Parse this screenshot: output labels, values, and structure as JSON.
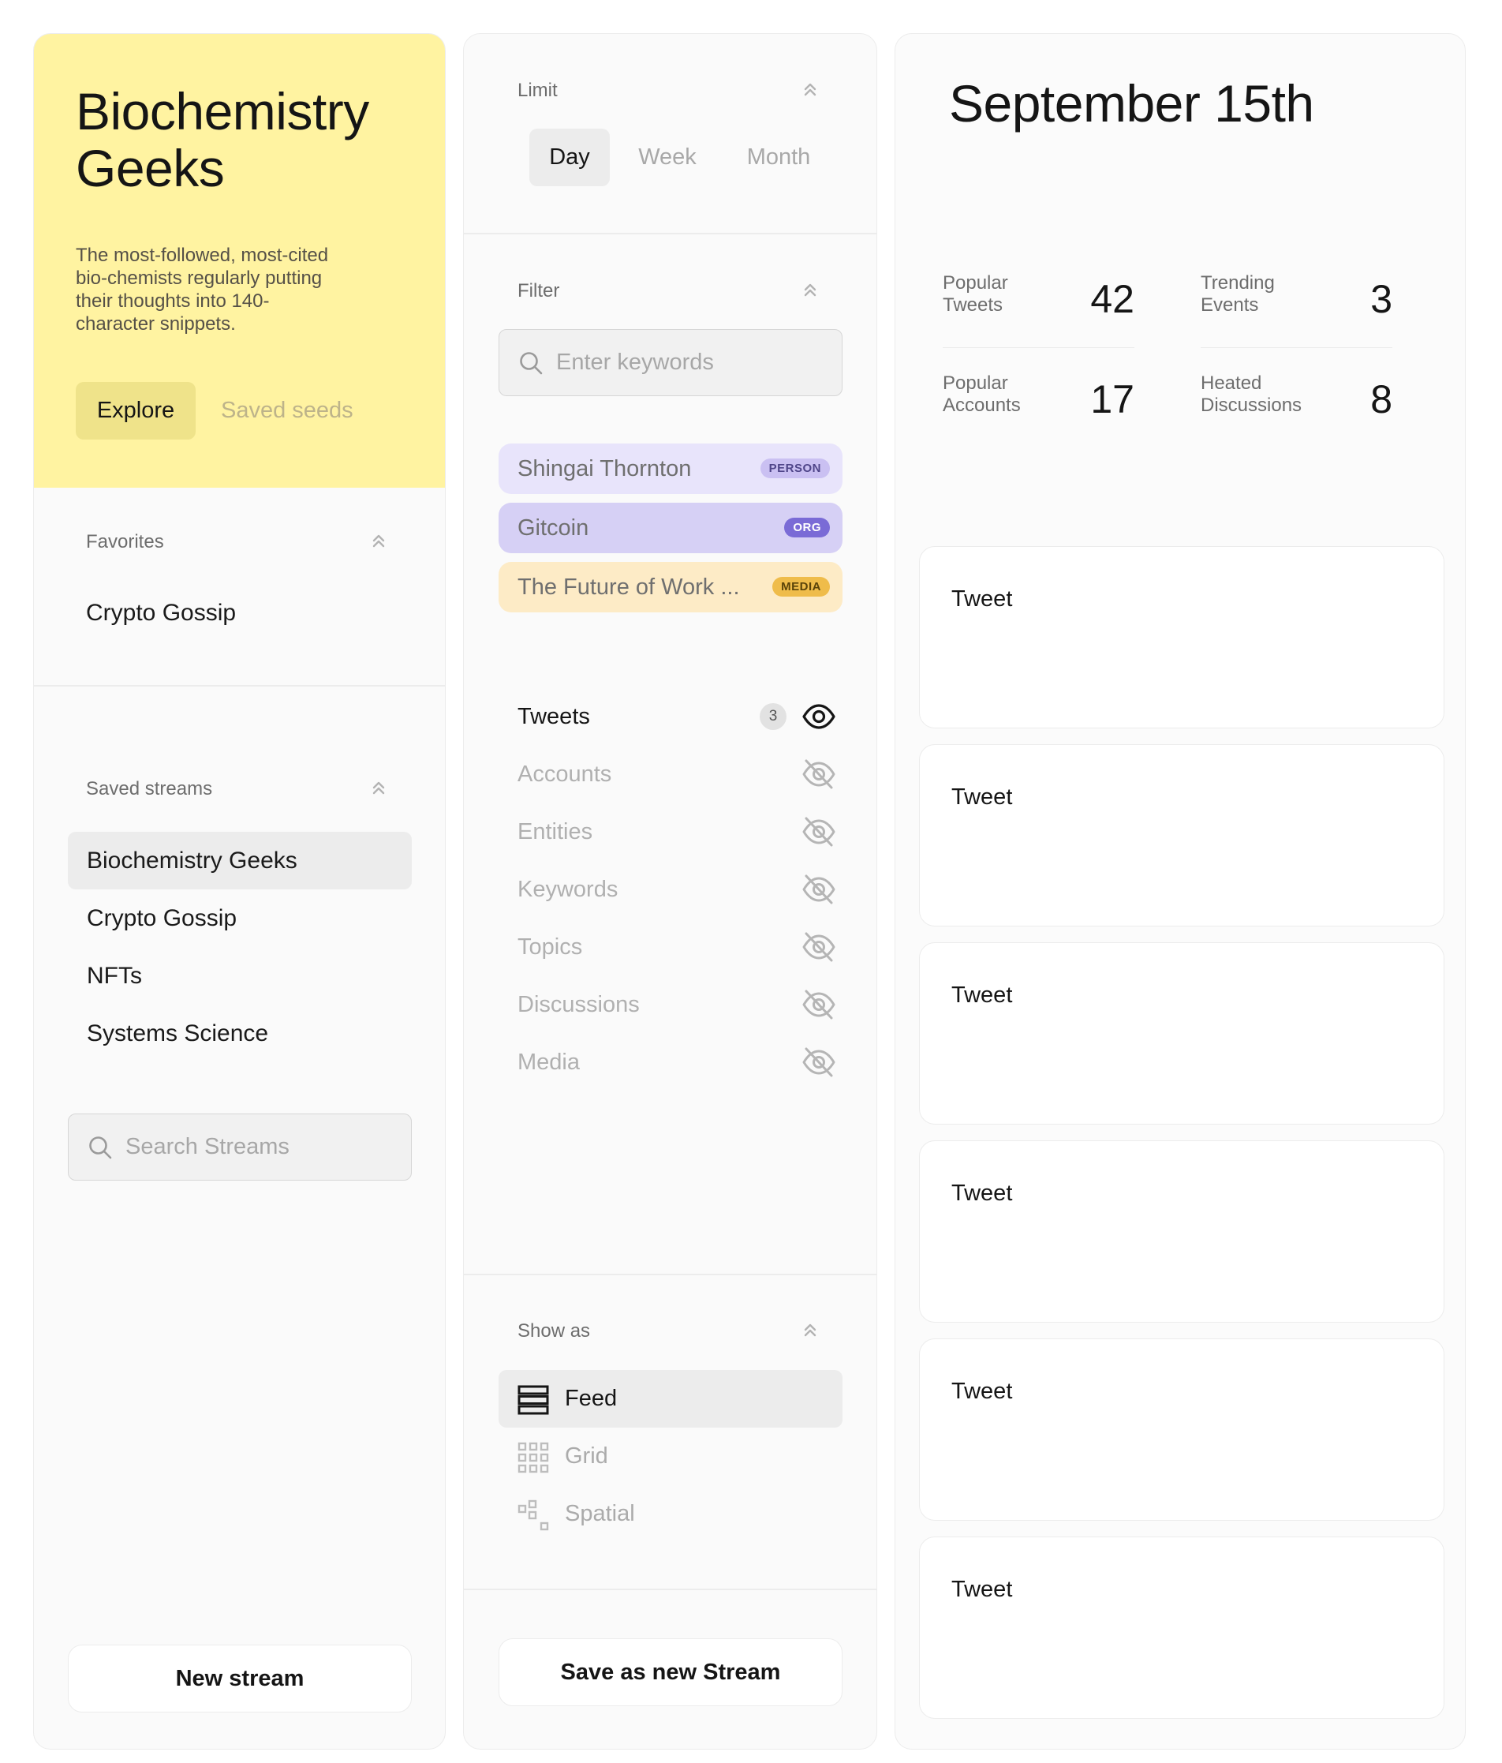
{
  "sidebar": {
    "title": "Biochemistry Geeks",
    "description": "The most-followed, most-cited bio-chemists regularly putting their thoughts into 140-character snippets.",
    "tabs": [
      {
        "label": "Explore"
      },
      {
        "label": "Saved seeds"
      }
    ],
    "favorites": {
      "heading": "Favorites",
      "items": [
        {
          "label": "Crypto Gossip"
        }
      ]
    },
    "saved_streams": {
      "heading": "Saved streams",
      "selected": "Biochemistry Geeks",
      "items": [
        {
          "label": "Biochemistry Geeks"
        },
        {
          "label": "Crypto Gossip"
        },
        {
          "label": "NFTs"
        },
        {
          "label": "Systems Science"
        }
      ]
    },
    "search": {
      "placeholder": "Search Streams",
      "value": ""
    },
    "new_stream_label": "New stream"
  },
  "controls": {
    "limit": {
      "heading": "Limit",
      "selected": "Day",
      "options": [
        {
          "label": "Day"
        },
        {
          "label": "Week"
        },
        {
          "label": "Month"
        }
      ]
    },
    "filter": {
      "heading": "Filter",
      "search": {
        "placeholder": "Enter keywords",
        "value": ""
      },
      "chips": [
        {
          "label": "Shingai Thornton",
          "badge": "PERSON"
        },
        {
          "label": "Gitcoin",
          "badge": "ORG"
        },
        {
          "label": "The Future of Work ...",
          "badge": "MEDIA"
        }
      ]
    },
    "types": [
      {
        "label": "Tweets",
        "count": "3",
        "visible": true
      },
      {
        "label": "Accounts",
        "visible": false
      },
      {
        "label": "Entities",
        "visible": false
      },
      {
        "label": "Keywords",
        "visible": false
      },
      {
        "label": "Topics",
        "visible": false
      },
      {
        "label": "Discussions",
        "visible": false
      },
      {
        "label": "Media",
        "visible": false
      }
    ],
    "show_as": {
      "heading": "Show as",
      "selected": "Feed",
      "options": [
        {
          "label": "Feed",
          "icon": "feed-icon"
        },
        {
          "label": "Grid",
          "icon": "grid-icon"
        },
        {
          "label": "Spatial",
          "icon": "spatial-icon"
        }
      ]
    },
    "save_label": "Save as new Stream"
  },
  "main": {
    "date_title": "September 15th",
    "stats": [
      {
        "label": "Popular Tweets",
        "value": "42"
      },
      {
        "label": "Trending Events",
        "value": "3"
      },
      {
        "label": "Popular Accounts",
        "value": "17"
      },
      {
        "label": "Heated Discussions",
        "value": "8"
      }
    ],
    "cards": [
      {
        "label": "Tweet"
      },
      {
        "label": "Tweet"
      },
      {
        "label": "Tweet"
      },
      {
        "label": "Tweet"
      },
      {
        "label": "Tweet"
      },
      {
        "label": "Tweet"
      }
    ]
  },
  "colors": {
    "hero_bg": "#fff3a1",
    "person_chip": "#e8e4fb",
    "org_chip": "#d6d0f5",
    "media_chip": "#fdebc6",
    "panel_bg": "#fafafa"
  }
}
